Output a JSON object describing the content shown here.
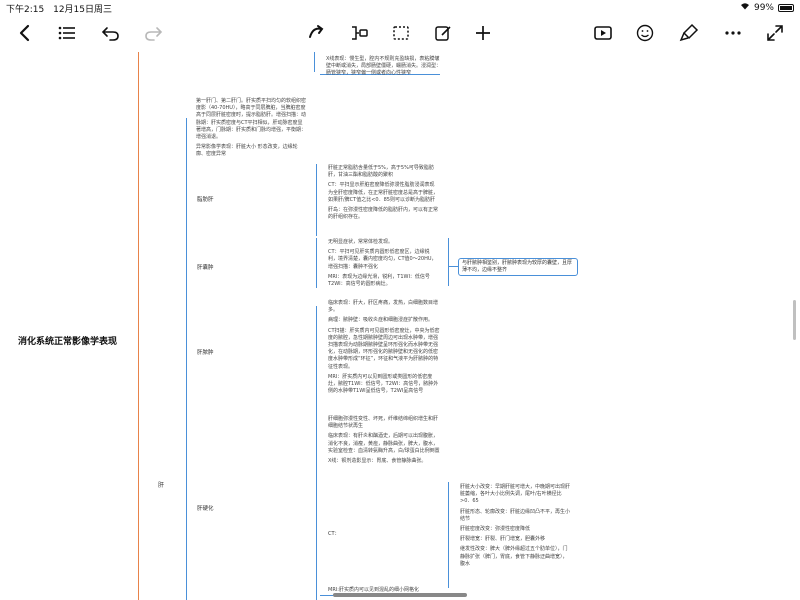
{
  "status": {
    "time": "下午2:15",
    "date": "12月15日周三",
    "battery": "99%"
  },
  "toolbar": {
    "icons": [
      "back-icon",
      "outline-icon",
      "undo-icon",
      "redo-icon",
      "connector-icon",
      "branch-icon",
      "select-icon",
      "edit-icon",
      "add-icon",
      "play-icon",
      "emoji-icon",
      "style-icon",
      "more-icon",
      "fullscreen-icon"
    ],
    "colors": {
      "branch": "#e8834a",
      "topic": "#4a90d9",
      "disabled": "#b8b8b8"
    }
  },
  "mindmap": {
    "root": "消化系统正常影像学表现",
    "liver": "肝",
    "top_snippet": "X线表现：慢生型，腔内不规则充盈缺损，表粘膜皱壁中断或消失，局部肠壁僵硬，蠕肠消失。浸润型：肠管狭窄，狭窄偏一侧或者向心性狭窄",
    "intro": [
      "第一肝门、第二肝门。肝实质平扫均匀的软组织密度影（40-70HU），略高于同层脾脏，当脾脏密度高于同层肝脏密度时，提示脂肪肝。增强扫描：动脉期：肝实质密度与CT平扫相似，肝动脉密度显著增高，门脉期：肝实质和门脉均增强，平衡期：增强消退。",
      "异常影像学表现：肝脏大小 形态改变，边缘轮廓、密度异常"
    ],
    "fatty": {
      "label": "脂肪肝",
      "lines": [
        "肝脏正常脂肪含量低于5%，高于5%可导致脂肪肝，甘油三酯和脂肪酸的聚积",
        "CT：平扫显示肝脏密度降低弥漫性脂肪浸润表现为全肝密度降低，在正常肝脏密度总是高于脾脏，如果肝/脾CT值之比<0．85则可以诊断为脂肪肝",
        "肝岛：在弥漫性密度降低的脂肪肝内，可以有正常的肝组织存在。"
      ]
    },
    "cyst": {
      "label": "肝囊肿",
      "lines": [
        "无明显症状，常常体检发现。",
        "CT：平扫可见肝实质内圆形低密度区，边缘锐利，境界清楚，囊内密度均匀，CT值0～20HU，增强扫描：囊肿不强化",
        "MRI：表现为边缘光滑，锐利，T1WI：低信号T2WI：高信号的圆形病灶。"
      ],
      "callout": "与肝脓肿相鉴别，肝脓肿表现为较厚的囊壁，且厚薄不均，边缘不整齐"
    },
    "abscess": {
      "label": "肝脓肿",
      "lines": [
        "临床表现：肝大，肝区疼痛，发热，白细胞数目增多。",
        "病理：脓肿壁：吸收炎症和细胞浸症扩散作用。",
        "CT扫描：肝实质内可见圆形低密度灶，中央为低密度的脓腔，急性期脓肿壁周边可出现水肿带，增强扫描表现为动脉期脓肿壁呈环形强化而水肿带无强化，在动脉期，环形强化的脓肿壁和无强化的低密度水肿带形成“环征”，环征和气液平为肝脓肿的特征性表现。",
        "MRI：肝实质内可以见到圆形或类圆形的低密度灶，脓腔T1WI：低信号，T2WI：高信号，脓肿外侧的水肿带T1WI呈低信号，T2WI呈高信号"
      ]
    },
    "cirrhosis": {
      "label": "肝硬化",
      "lines": [
        "肝细胞弥漫性变性、坏死，纤维结缔组织增生和肝细胞结节状再生",
        "临床表现：有肝炎和酗酒史，后期可以出现腹胀，消化不良，消瘦，黄疸，静脉曲张，脾大，腹水，实验室检查：血清转氨酶升高，白/球蛋白比例倒置",
        "X线：钡剂造影显示：胃底、食管静脉曲张。"
      ],
      "ct_label": "CT：",
      "ct_lines": [
        "肝脏大小改变：早期肝脏可增大，中晚期可出现肝脏萎缩，各叶大小比例失调，尾叶/右叶横径比>0．65",
        "肝脏形态、轮廓改变：肝脏边缘凹凸不平，再生小结节",
        "肝脏密度改变：弥漫性密度降低",
        "肝裂增宽：肝裂、肝门增宽，胆囊外移",
        "继发性改变：脾大（脾外缘超过五个肋单位），门静脉扩张（脾门，胃底，食管下静脉迂曲增宽），腹水"
      ],
      "mri": "MRI:肝实质内可以见到混乱的细小网格化"
    }
  }
}
